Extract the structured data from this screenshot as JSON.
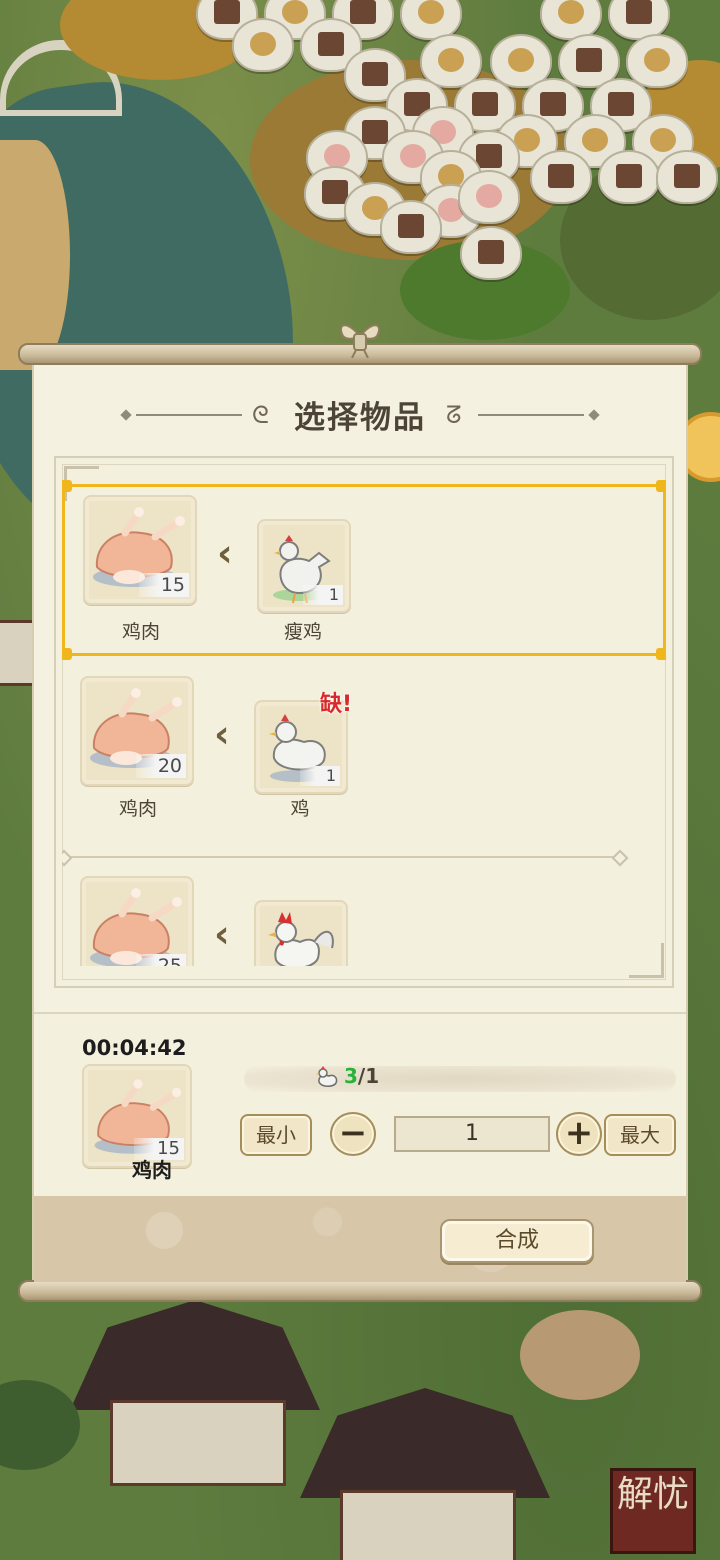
{
  "dialog": {
    "title": "选择物品"
  },
  "recipes": [
    {
      "output_name": "鸡肉",
      "output_qty": "15",
      "input_name": "瘦鸡",
      "input_qty": "1",
      "selected": true,
      "missing_label": ""
    },
    {
      "output_name": "鸡肉",
      "output_qty": "20",
      "input_name": "鸡",
      "input_qty": "1",
      "selected": false,
      "missing_label": "缺!"
    },
    {
      "output_name": "鸡肉",
      "output_qty": "25",
      "input_name": "",
      "input_qty": "",
      "selected": false,
      "missing_label": ""
    }
  ],
  "craft": {
    "timer": "00:04:42",
    "output_name": "鸡肉",
    "output_qty": "15",
    "progress_have": "3",
    "progress_sep_need": "/1",
    "min_label": "最小",
    "max_label": "最大",
    "minus_label": "−",
    "plus_label": "+",
    "quantity": "1",
    "craft_label": "合成"
  },
  "side": {
    "corner_button_label": "解忧"
  },
  "colors": {
    "selection": "#f0b71c",
    "missing": "#d82a2a",
    "have_count": "#27b23a"
  },
  "icons": [
    "roast-chicken-icon",
    "thin-chicken-icon",
    "hen-icon",
    "rooster-icon",
    "chicken-mini-icon",
    "bow-knot-icon"
  ]
}
